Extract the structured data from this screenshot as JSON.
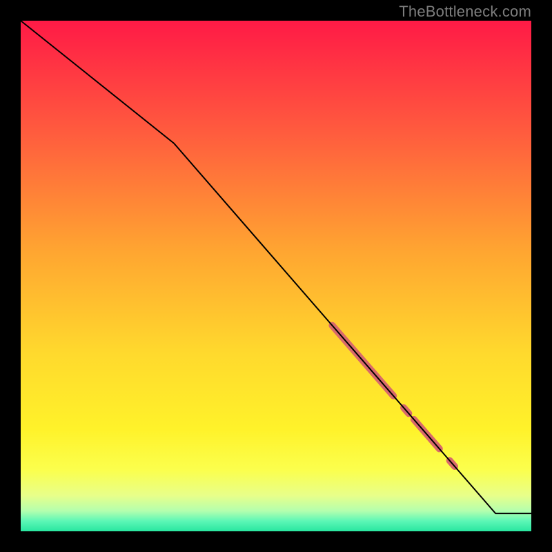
{
  "watermark": "TheBottleneck.com",
  "colors": {
    "frame_bg": "#000000",
    "line": "#000000",
    "highlight": "#d86a6a",
    "gradient_stops": [
      {
        "pct": 0,
        "color": "#ff1a46"
      },
      {
        "pct": 22,
        "color": "#ff5c3e"
      },
      {
        "pct": 45,
        "color": "#ffa531"
      },
      {
        "pct": 65,
        "color": "#ffd92d"
      },
      {
        "pct": 80,
        "color": "#fff22a"
      },
      {
        "pct": 88,
        "color": "#fbff4d"
      },
      {
        "pct": 93,
        "color": "#e8ff8a"
      },
      {
        "pct": 96,
        "color": "#b4ffae"
      },
      {
        "pct": 98,
        "color": "#5cf7b6"
      },
      {
        "pct": 100,
        "color": "#29e6a0"
      }
    ]
  },
  "chart_data": {
    "type": "line",
    "title": "",
    "xlabel": "",
    "ylabel": "",
    "xlim": [
      0,
      100
    ],
    "ylim": [
      0,
      100
    ],
    "grid": false,
    "legend": false,
    "series": [
      {
        "name": "main-curve",
        "x": [
          0,
          30,
          93,
          100
        ],
        "y": [
          100,
          76,
          3.5,
          3.5
        ],
        "note": "piecewise-linear: steep→knee at ~x30→long linear descent→flat tail from ~x93"
      }
    ],
    "highlights": [
      {
        "name": "band-1",
        "x0": 61,
        "x1": 73,
        "thickness": 10
      },
      {
        "name": "dot-1",
        "x0": 75,
        "x1": 76,
        "thickness": 10
      },
      {
        "name": "band-2",
        "x0": 77,
        "x1": 82,
        "thickness": 10
      },
      {
        "name": "dot-2",
        "x0": 84,
        "x1": 85,
        "thickness": 10
      }
    ]
  }
}
